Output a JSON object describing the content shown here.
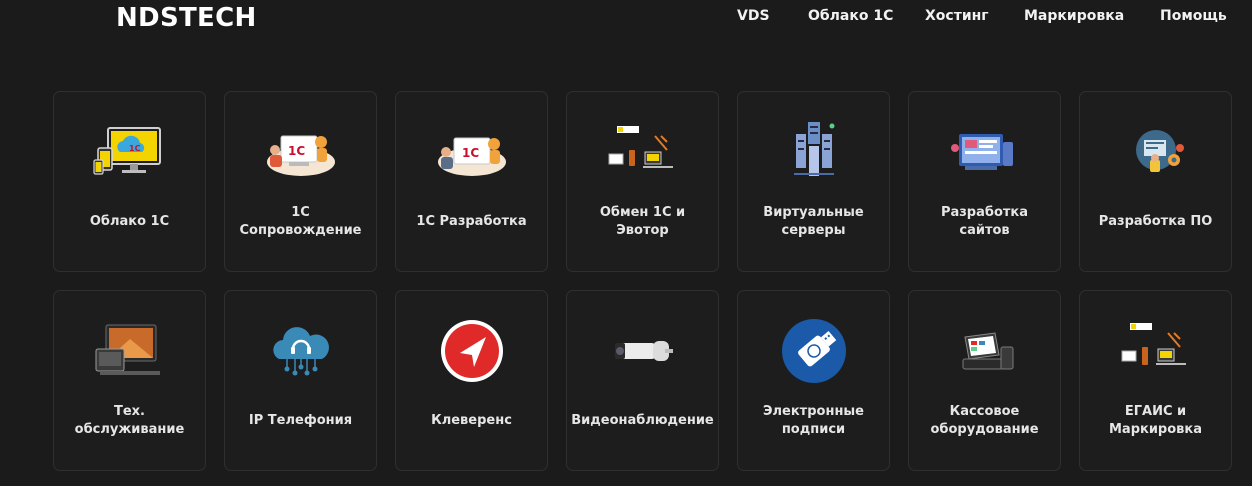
{
  "header": {
    "logo": "NDSTECH",
    "nav": [
      {
        "label": "VDS"
      },
      {
        "label": "Облако 1С"
      },
      {
        "label": "Хостинг"
      },
      {
        "label": "Маркировка"
      },
      {
        "label": "Помощь"
      }
    ]
  },
  "services": [
    {
      "label": "Облако 1С",
      "icon": "cloud-1c-devices-icon"
    },
    {
      "label": "1С Сопровождение",
      "icon": "1c-support-illustration-icon"
    },
    {
      "label": "1С Разработка",
      "icon": "1c-development-illustration-icon"
    },
    {
      "label": "Обмен 1С и Эвотор",
      "icon": "1c-evotor-exchange-icon"
    },
    {
      "label": "Виртуальные серверы",
      "icon": "server-racks-icon"
    },
    {
      "label": "Разработка сайтов",
      "icon": "web-development-icon"
    },
    {
      "label": "Разработка ПО",
      "icon": "software-development-icon"
    },
    {
      "label": "Тех. обслуживание",
      "icon": "computer-maintenance-icon"
    },
    {
      "label": "IP Телефония",
      "icon": "cloud-headset-icon"
    },
    {
      "label": "Клеверенс",
      "icon": "cleverence-logo-icon"
    },
    {
      "label": "Видеонаблюдение",
      "icon": "cctv-camera-icon"
    },
    {
      "label": "Электронные подписи",
      "icon": "usb-token-icon"
    },
    {
      "label": "Кассовое оборудование",
      "icon": "pos-terminal-icon"
    },
    {
      "label": "ЕГАИС и Маркировка",
      "icon": "egais-marking-icon"
    }
  ],
  "colors": {
    "background": "#1b1b1b",
    "card_background": "#1d1d1d",
    "card_border": "#2f2f2f",
    "text": "#e6e6e6"
  }
}
